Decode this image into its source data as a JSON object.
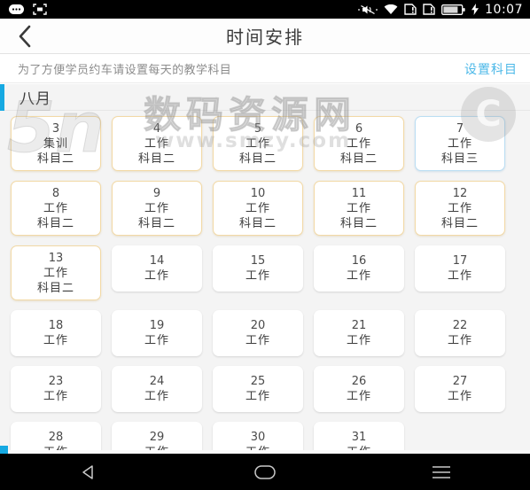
{
  "statusbar": {
    "time": "10:07",
    "icons_left": [
      "messages-icon",
      "screenshot-capture-icon"
    ],
    "icons_right": [
      "silent-mode-icon",
      "wifi-icon",
      "sim1-icon",
      "sim2-icon",
      "battery-icon",
      "charging-bolt-icon"
    ]
  },
  "titlebar": {
    "back_icon": "back-chevron-icon",
    "title": "时间安排"
  },
  "hint": {
    "text": "为了方便学员约车请设置每天的教学科目",
    "link": "设置科目"
  },
  "month": {
    "label": "八月",
    "accent_color": "#16a9e2"
  },
  "colors": {
    "subject2_border": "#f2d9a6",
    "subject3_border": "#bbdef3",
    "link": "#4cb8e8",
    "page_bg": "#f4f4f4"
  },
  "days": [
    {
      "num": "3",
      "type": "集训",
      "subject": "科目二",
      "style": "k2"
    },
    {
      "num": "4",
      "type": "工作",
      "subject": "科目二",
      "style": "k2"
    },
    {
      "num": "5",
      "type": "工作",
      "subject": "科目二",
      "style": "k2"
    },
    {
      "num": "6",
      "type": "工作",
      "subject": "科目二",
      "style": "k2"
    },
    {
      "num": "7",
      "type": "工作",
      "subject": "科目三",
      "style": "k3"
    },
    {
      "num": "8",
      "type": "工作",
      "subject": "科目二",
      "style": "k2"
    },
    {
      "num": "9",
      "type": "工作",
      "subject": "科目二",
      "style": "k2"
    },
    {
      "num": "10",
      "type": "工作",
      "subject": "科目二",
      "style": "k2"
    },
    {
      "num": "11",
      "type": "工作",
      "subject": "科目二",
      "style": "k2"
    },
    {
      "num": "12",
      "type": "工作",
      "subject": "科目二",
      "style": "k2"
    },
    {
      "num": "13",
      "type": "工作",
      "subject": "科目二",
      "style": "k2"
    },
    {
      "num": "14",
      "type": "工作",
      "subject": "",
      "style": "plain"
    },
    {
      "num": "15",
      "type": "工作",
      "subject": "",
      "style": "plain"
    },
    {
      "num": "16",
      "type": "工作",
      "subject": "",
      "style": "plain"
    },
    {
      "num": "17",
      "type": "工作",
      "subject": "",
      "style": "plain"
    },
    {
      "num": "18",
      "type": "工作",
      "subject": "",
      "style": "plain"
    },
    {
      "num": "19",
      "type": "工作",
      "subject": "",
      "style": "plain"
    },
    {
      "num": "20",
      "type": "工作",
      "subject": "",
      "style": "plain"
    },
    {
      "num": "21",
      "type": "工作",
      "subject": "",
      "style": "plain"
    },
    {
      "num": "22",
      "type": "工作",
      "subject": "",
      "style": "plain"
    },
    {
      "num": "23",
      "type": "工作",
      "subject": "",
      "style": "plain"
    },
    {
      "num": "24",
      "type": "工作",
      "subject": "",
      "style": "plain"
    },
    {
      "num": "25",
      "type": "工作",
      "subject": "",
      "style": "plain"
    },
    {
      "num": "26",
      "type": "工作",
      "subject": "",
      "style": "plain"
    },
    {
      "num": "27",
      "type": "工作",
      "subject": "",
      "style": "plain"
    },
    {
      "num": "28",
      "type": "工作",
      "subject": "",
      "style": "plain"
    },
    {
      "num": "29",
      "type": "工作",
      "subject": "",
      "style": "plain"
    },
    {
      "num": "30",
      "type": "工作",
      "subject": "",
      "style": "plain"
    },
    {
      "num": "31",
      "type": "工作",
      "subject": "",
      "style": "plain"
    }
  ],
  "watermark": {
    "cn": "数码资源网",
    "url": "www.smzy.com",
    "logo": "5n",
    "badge": "C"
  },
  "navbar": {
    "back": "android-back-icon",
    "home": "android-home-icon",
    "recents": "android-recents-icon"
  }
}
